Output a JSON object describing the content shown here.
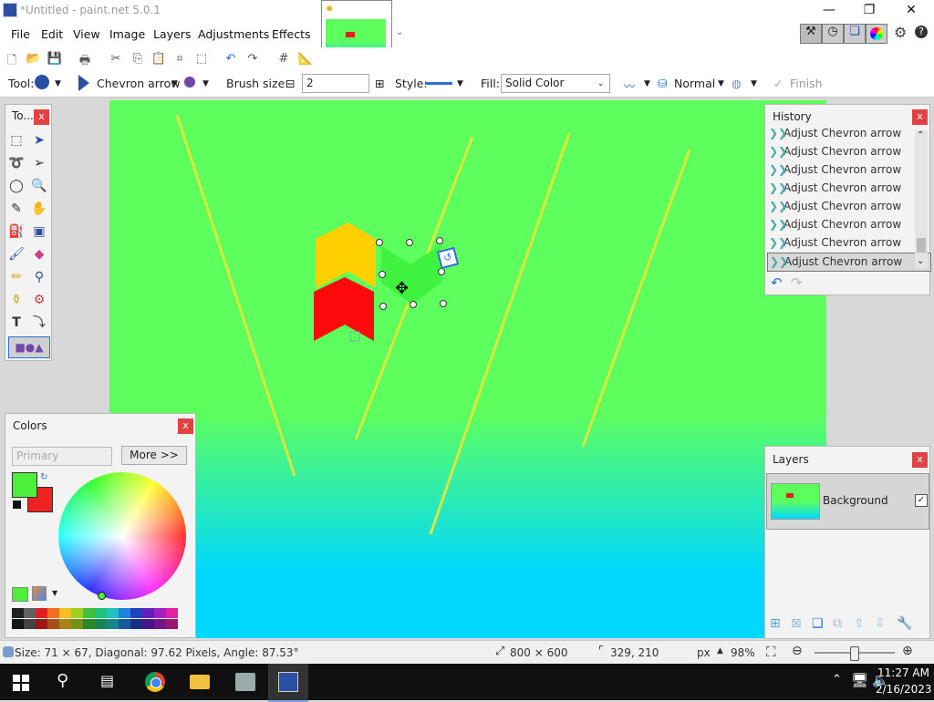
{
  "app": {
    "title": "*Untitled - paint.net 5.0.1",
    "win_minimize": "—",
    "win_restore": "❐",
    "win_close": "✕"
  },
  "menu": [
    "File",
    "Edit",
    "View",
    "Image",
    "Layers",
    "Adjustments",
    "Effects"
  ],
  "toolbar": {
    "tool_label": "Tool:",
    "tool_name": "Chevron arrow",
    "brush_label": "Brush size:",
    "brush_value": "2",
    "style_label": "Style:",
    "fill_label": "Fill:",
    "fill_value": "Solid Color",
    "blend_value": "Normal",
    "finish_label": "Finish"
  },
  "panels": {
    "tools_title": "To...",
    "colors_title": "Colors",
    "colors_mode": "Primary",
    "colors_more": "More >>",
    "history_title": "History",
    "history_items": [
      "Adjust Chevron arrow",
      "Adjust Chevron arrow",
      "Adjust Chevron arrow",
      "Adjust Chevron arrow",
      "Adjust Chevron arrow",
      "Adjust Chevron arrow",
      "Adjust Chevron arrow",
      "Adjust Chevron arrow"
    ],
    "layers_title": "Layers",
    "layer_name": "Background",
    "close_label": "x"
  },
  "status": {
    "info": "Size: 71 × 67, Diagonal: 97.62 Pixels, Angle: 87.53°",
    "image_size": "800 × 600",
    "cursor_pos": "329, 210",
    "unit": "px",
    "zoom": "98%"
  },
  "taskbar": {
    "time": "11:27 AM",
    "date": "2/16/2023"
  },
  "colors": {
    "primary": "#4cf03a",
    "secondary": "#ee2222",
    "accent": "#2a6fd6",
    "canvas_green": "#5dff5d",
    "canvas_cyan": "#00d8ff"
  },
  "palette": [
    "#202020",
    "#606060",
    "#e02020",
    "#f07020",
    "#f0c020",
    "#a0d020",
    "#40c040",
    "#20c080",
    "#20c0c0",
    "#2080e0",
    "#2040c0",
    "#6020c0",
    "#a020c0",
    "#e020a0"
  ]
}
